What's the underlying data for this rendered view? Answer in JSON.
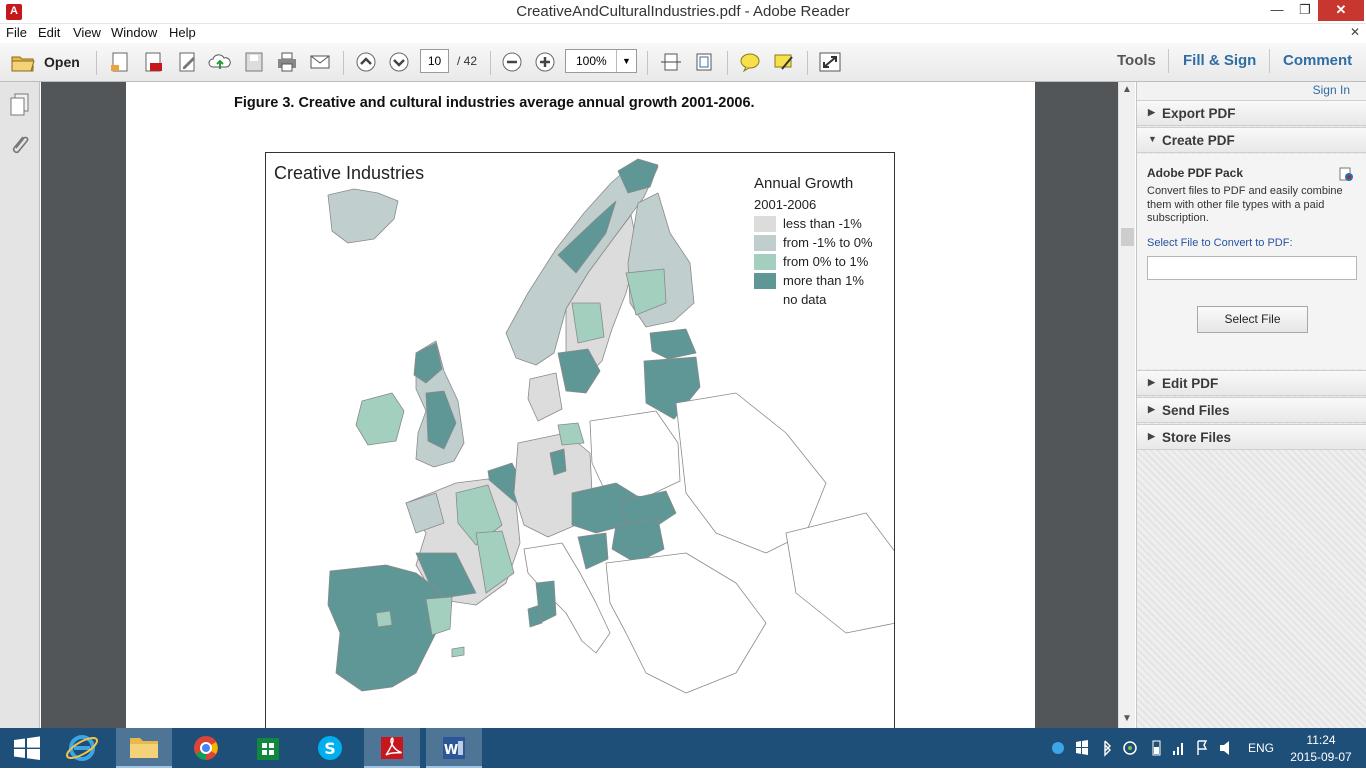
{
  "window": {
    "title": "CreativeAndCulturalIndustries.pdf - Adobe Reader",
    "min": "—",
    "max": "❐",
    "close": "✕"
  },
  "menu": {
    "file": "File",
    "edit": "Edit",
    "view": "View",
    "window": "Window",
    "help": "Help",
    "close_doc": "✕"
  },
  "toolbar": {
    "open_label": "Open",
    "page_current": "10",
    "page_total": "/ 42",
    "zoom": "100%"
  },
  "tabs": {
    "tools": "Tools",
    "fill_sign": "Fill & Sign",
    "comment": "Comment"
  },
  "document": {
    "caption": "Figure 3. Creative and cultural industries average annual growth 2001-2006.",
    "map_title": "Creative Industries",
    "legend_title": "Annual Growth",
    "legend_subtitle": "2001-2006",
    "legend": [
      {
        "label": "less than -1%",
        "color": "#dcdcdc"
      },
      {
        "label": "from -1% to 0%",
        "color": "#c0cfcd"
      },
      {
        "label": "from 0% to 1%",
        "color": "#a3cfbf"
      },
      {
        "label": "more than 1%",
        "color": "#5f9796"
      },
      {
        "label": "no data",
        "color": "#ffffff"
      }
    ]
  },
  "right_pane": {
    "sign_in": "Sign In",
    "export_pdf": "Export PDF",
    "create_pdf": "Create PDF",
    "pack_title": "Adobe PDF Pack",
    "pack_desc": "Convert files to PDF and easily combine them with other file types with a paid subscription.",
    "select_label": "Select File to Convert to PDF:",
    "select_button": "Select File",
    "edit_pdf": "Edit PDF",
    "send_files": "Send Files",
    "store_files": "Store Files"
  },
  "taskbar": {
    "lang": "ENG",
    "time": "11:24",
    "date": "2015-09-07"
  },
  "colors": {
    "taskbar": "#1d4f79",
    "accent": "#2f6da3",
    "doc_bg": "#525659"
  }
}
